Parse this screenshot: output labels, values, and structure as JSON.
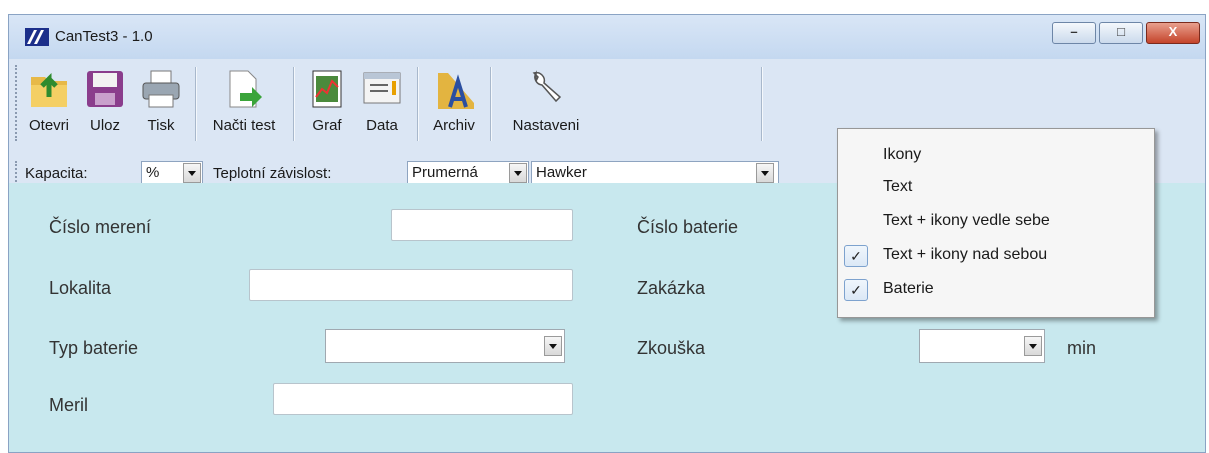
{
  "window": {
    "title": "CanTest3 - 1.0",
    "controls": {
      "minimize": "–",
      "maximize": "□",
      "close": "X"
    }
  },
  "toolbar": {
    "buttons": [
      {
        "id": "open",
        "label": "Otevri",
        "icon": "open-folder-icon"
      },
      {
        "id": "save",
        "label": "Uloz",
        "icon": "floppy-disk-icon"
      },
      {
        "id": "print",
        "label": "Tisk",
        "icon": "printer-icon"
      },
      {
        "id": "load-test",
        "label": "Načti test",
        "icon": "import-document-icon"
      },
      {
        "id": "graph",
        "label": "Graf",
        "icon": "chart-icon"
      },
      {
        "id": "data",
        "label": "Data",
        "icon": "data-window-icon"
      },
      {
        "id": "archive",
        "label": "Archiv",
        "icon": "archive-folder-icon"
      },
      {
        "id": "settings",
        "label": "Nastaveni",
        "icon": "wrench-icon"
      }
    ],
    "combos": {
      "capacity_label": "Kapacita:",
      "capacity_value": "%",
      "temp_label": "Teplotní závislost:",
      "temp_value": "Prumerná",
      "brand_value": "Hawker"
    }
  },
  "form": {
    "measurement_number_label": "Číslo merení",
    "battery_number_label": "Číslo baterie",
    "location_label": "Lokalita",
    "order_label": "Zakázka",
    "battery_type_label": "Typ baterie",
    "test_label": "Zkouška",
    "test_unit": "min",
    "measured_by_label": "Meril"
  },
  "context_menu": {
    "items": [
      {
        "label": "Ikony",
        "checked": false
      },
      {
        "label": "Text",
        "checked": false
      },
      {
        "label": "Text + ikony vedle sebe",
        "checked": false
      },
      {
        "label": "Text + ikony nad sebou",
        "checked": true
      },
      {
        "label": "Baterie",
        "checked": true
      }
    ],
    "check_glyph": "✓"
  },
  "colors": {
    "window_frame": "#c3d9f1",
    "toolbar_bg": "#dbe6f4",
    "form_bg": "#c8e8ee",
    "menu_bg": "#f6f6f6",
    "close_button": "#c4442b"
  }
}
